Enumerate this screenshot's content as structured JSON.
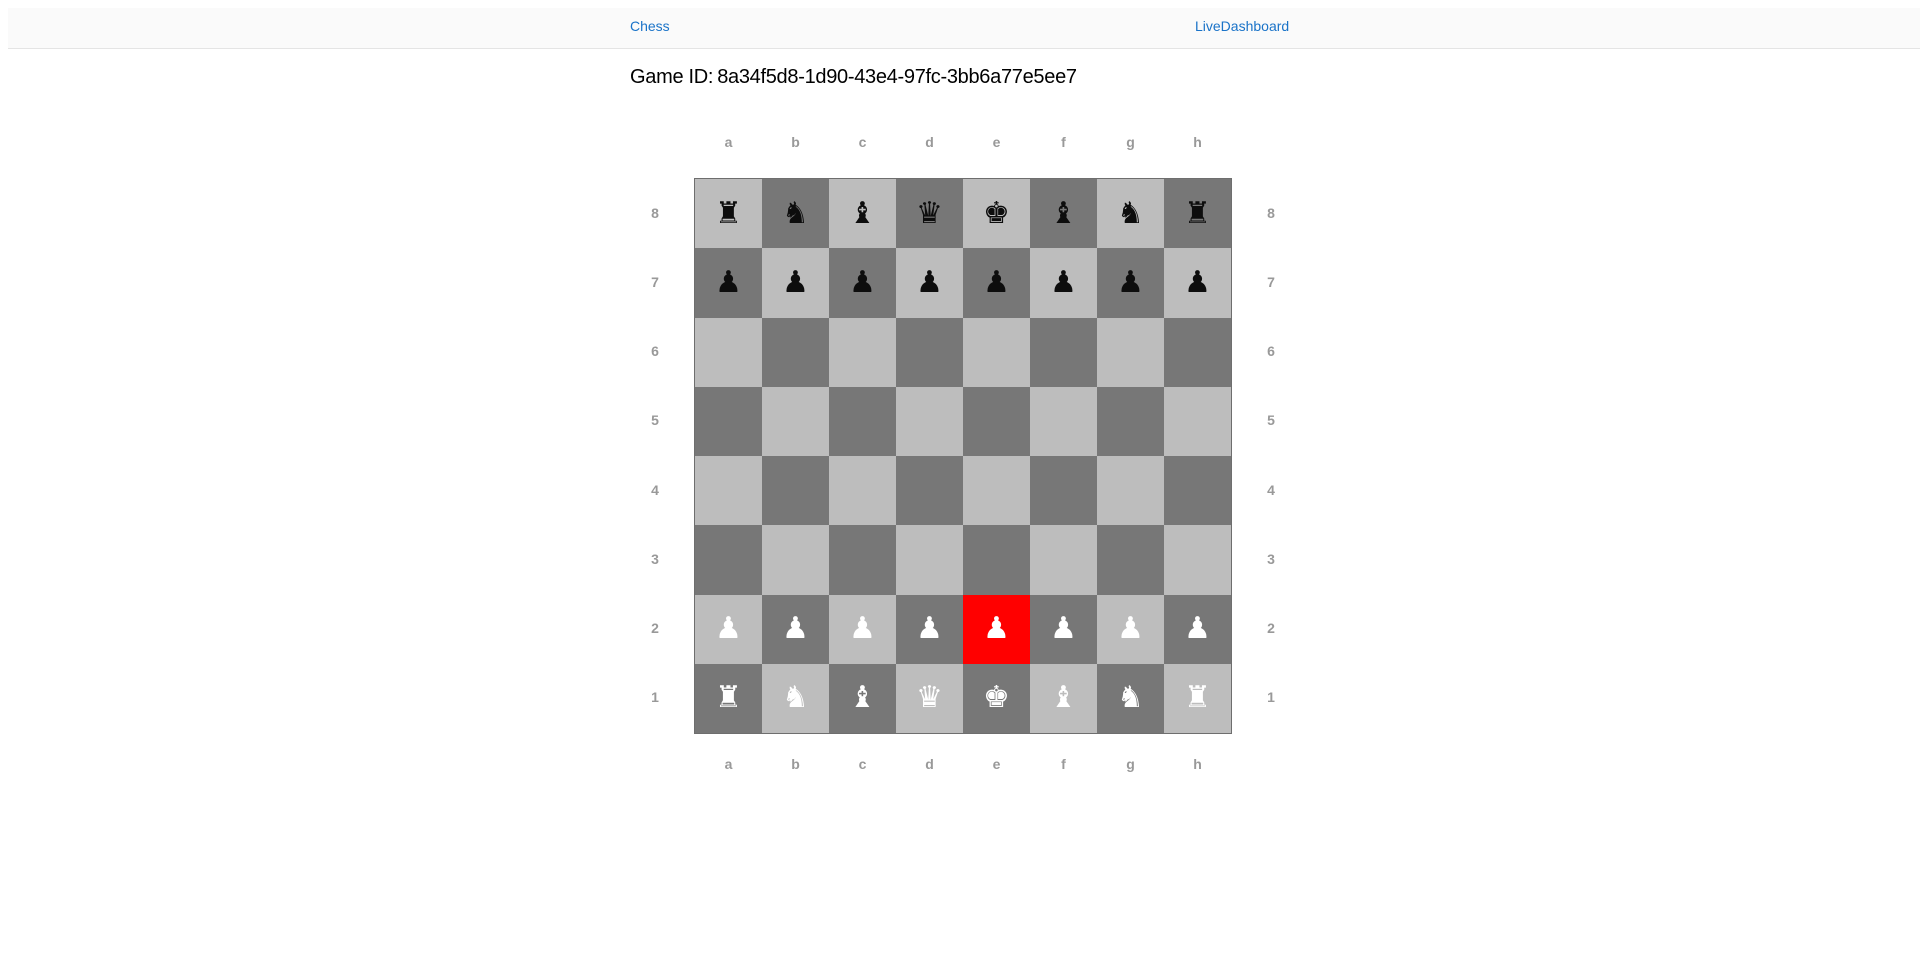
{
  "nav": {
    "chess_label": "Chess",
    "dashboard_label": "LiveDashboard"
  },
  "game": {
    "id_label": "Game ID:",
    "id_value": "8a34f5d8-1d90-43e4-97fc-3bb6a77e5ee7"
  },
  "board": {
    "files": [
      "a",
      "b",
      "c",
      "d",
      "e",
      "f",
      "g",
      "h"
    ],
    "ranks": [
      "8",
      "7",
      "6",
      "5",
      "4",
      "3",
      "2",
      "1"
    ],
    "colors": {
      "light": "#bdbdbd",
      "dark": "#777777",
      "highlight": "#ff0000"
    },
    "selected_square": "e2",
    "position": [
      [
        "br",
        "bn",
        "bb",
        "bq",
        "bk",
        "bb",
        "bn",
        "br"
      ],
      [
        "bp",
        "bp",
        "bp",
        "bp",
        "bp",
        "bp",
        "bp",
        "bp"
      ],
      [
        "",
        "",
        "",
        "",
        "",
        "",
        "",
        ""
      ],
      [
        "",
        "",
        "",
        "",
        "",
        "",
        "",
        ""
      ],
      [
        "",
        "",
        "",
        "",
        "",
        "",
        "",
        ""
      ],
      [
        "",
        "",
        "",
        "",
        "",
        "",
        "",
        ""
      ],
      [
        "wp",
        "wp",
        "wp",
        "wp",
        "wp",
        "wp",
        "wp",
        "wp"
      ],
      [
        "wr",
        "wn",
        "wb",
        "wq",
        "wk",
        "wb",
        "wn",
        "wr"
      ]
    ],
    "piece_icons": {
      "r": "rook-icon",
      "n": "knight-icon",
      "b": "bishop-icon",
      "q": "queen-icon",
      "k": "king-icon",
      "p": "pawn-icon"
    }
  }
}
